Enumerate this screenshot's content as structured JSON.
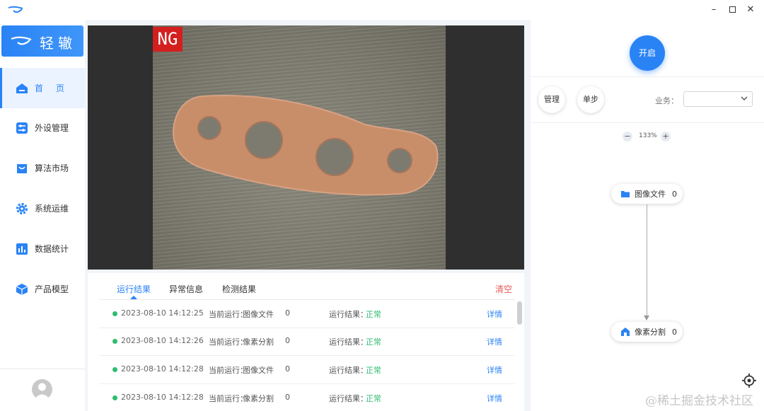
{
  "window": {
    "minimize": "–",
    "close": "✕"
  },
  "sidebar": {
    "brand": "轻辙",
    "items": [
      {
        "label": "首页",
        "icon": "home-icon",
        "active": true
      },
      {
        "label": "外设管理",
        "icon": "sliders-icon"
      },
      {
        "label": "算法市场",
        "icon": "bag-icon"
      },
      {
        "label": "系统运维",
        "icon": "gear-icon"
      },
      {
        "label": "数据统计",
        "icon": "bar-chart-icon"
      },
      {
        "label": "产品模型",
        "icon": "cube-icon"
      }
    ]
  },
  "viewer": {
    "badge": "NG"
  },
  "results": {
    "tabs": [
      "运行结果",
      "异常信息",
      "检测结果"
    ],
    "active_tab": 0,
    "clear_label": "清空",
    "rows": [
      {
        "time": "2023-08-10 14:12:25",
        "current_label": "当前运行：",
        "current_value": "图像文件",
        "count": "0",
        "result_label": "运行结果：",
        "result_value": "正常",
        "detail": "详情"
      },
      {
        "time": "2023-08-10 14:12:26",
        "current_label": "当前运行：",
        "current_value": "像素分割",
        "count": "0",
        "result_label": "运行结果：",
        "result_value": "正常",
        "detail": "详情"
      },
      {
        "time": "2023-08-10 14:12:28",
        "current_label": "当前运行：",
        "current_value": "图像文件",
        "count": "0",
        "result_label": "运行结果：",
        "result_value": "正常",
        "detail": "详情"
      },
      {
        "time": "2023-08-10 14:12:28",
        "current_label": "当前运行：",
        "current_value": "像素分割",
        "count": "0",
        "result_label": "运行结果：",
        "result_value": "正常",
        "detail": "详情"
      }
    ]
  },
  "right_panel": {
    "start_label": "开启",
    "manage_label": "管理",
    "step_label": "单步",
    "business_label": "业务：",
    "business_value": "",
    "zoom_minus": "−",
    "zoom_plus": "+",
    "zoom_value": "133%",
    "nodes": [
      {
        "label": "图像文件",
        "count": "0",
        "icon": "folder-icon"
      },
      {
        "label": "像素分割",
        "count": "0",
        "icon": "segment-icon"
      }
    ]
  },
  "watermark": "@稀土掘金技术社区",
  "colors": {
    "accent": "#2a83f5",
    "ok": "#2dbd6e",
    "danger": "#e85a5a",
    "ng_badge": "#d41f1f"
  }
}
